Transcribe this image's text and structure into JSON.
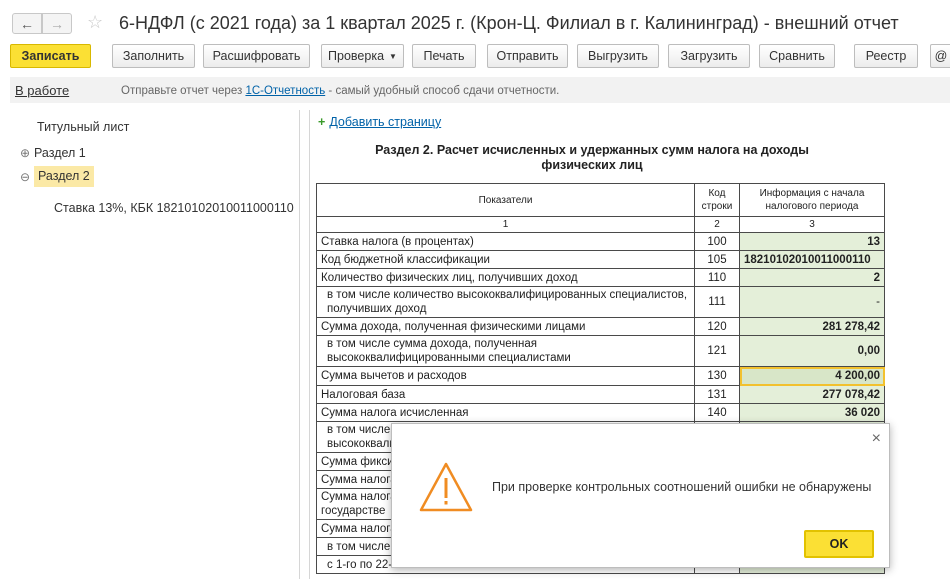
{
  "window": {
    "title": "6-НДФЛ (с 2021 года) за 1 квартал 2025 г. (Крон-Ц. Филиал в г. Калининград) - внешний отчет"
  },
  "toolbar": {
    "record": "Записать",
    "fill": "Заполнить",
    "decode": "Расшифровать",
    "check": "Проверка",
    "print": "Печать",
    "send": "Отправить",
    "upload": "Выгрузить",
    "load": "Загрузить",
    "compare": "Сравнить",
    "registry": "Реестр",
    "more": "@"
  },
  "status": {
    "state": "В работе",
    "msg_before": "Отправьте отчет через ",
    "msg_link": "1С-Отчетность",
    "msg_after": " - самый удобный способ сдачи отчетности."
  },
  "tree": {
    "title_sheet": "Титульный лист",
    "section1": "Раздел 1",
    "section2": "Раздел 2",
    "rate": "Ставка 13%, КБК 18210102010011000110"
  },
  "report": {
    "add_page": "Добавить страницу",
    "section_title": "Раздел 2. Расчет исчисленных и удержанных сумм налога на доходы физических лиц",
    "headers": {
      "indicator": "Показатели",
      "code": "Код строки",
      "info": "Информация с начала налогового периода"
    },
    "colnums": [
      "1",
      "2",
      "3"
    ],
    "rows": [
      {
        "label": "Ставка налога (в процентах)",
        "code": "100",
        "value": "13"
      },
      {
        "label": "Код бюджетной классификации",
        "code": "105",
        "value": "18210102010011000110"
      },
      {
        "label": "Количество физических лиц, получивших доход",
        "code": "110",
        "value": "2"
      },
      {
        "label": "в том числе количество высококвалифицированных специалистов, получивших доход",
        "code": "111",
        "value": "-"
      },
      {
        "label": "Сумма дохода, полученная физическими лицами",
        "code": "120",
        "value": "281 278,42"
      },
      {
        "label": "в том числе сумма дохода, полученная высококвалифицированными специалистами",
        "code": "121",
        "value": "0,00"
      },
      {
        "label": "Сумма вычетов и расходов",
        "code": "130",
        "value": "4 200,00"
      },
      {
        "label": "Налоговая база",
        "code": "131",
        "value": "277 078,42"
      },
      {
        "label": "Сумма налога исчисленная",
        "code": "140",
        "value": "36 020"
      },
      {
        "label": "в том числе",
        "label2": "высококвали",
        "code": "",
        "value": ""
      },
      {
        "label": "Сумма фикси",
        "code": "",
        "value": ""
      },
      {
        "label": "Сумма налога",
        "code": "",
        "value": ""
      },
      {
        "label": "Сумма налога",
        "label2": "государстве",
        "code": "",
        "value": ""
      },
      {
        "label": "Сумма налога",
        "code": "",
        "value": ""
      },
      {
        "label": "в том числе",
        "code": "",
        "value": ""
      },
      {
        "label": "с 1-го по 22-",
        "code": "",
        "value": ""
      }
    ]
  },
  "dialog": {
    "close": "×",
    "message": "При проверке контрольных соотношений ошибки не обнаружены",
    "ok": "OK"
  }
}
